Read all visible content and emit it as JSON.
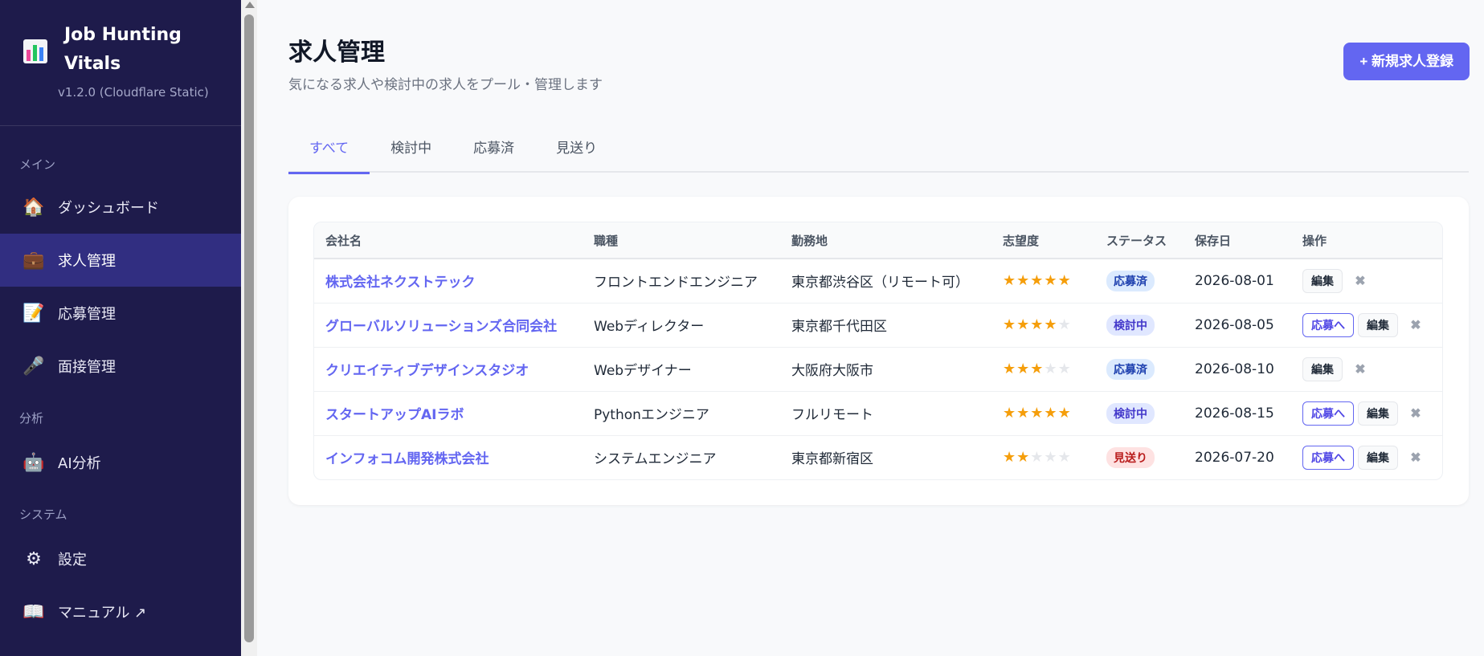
{
  "app": {
    "title": "Job Hunting Vitals",
    "version": "v1.2.0 (Cloudflare Static)"
  },
  "sidebar": {
    "sections": {
      "main": "メイン",
      "analysis": "分析",
      "system": "システム"
    },
    "items": [
      {
        "label": "ダッシュボード",
        "icon": "house-icon"
      },
      {
        "label": "求人管理",
        "icon": "briefcase-icon"
      },
      {
        "label": "応募管理",
        "icon": "memo-icon"
      },
      {
        "label": "面接管理",
        "icon": "microphone-icon"
      },
      {
        "label": "AI分析",
        "icon": "robot-icon"
      },
      {
        "label": "設定",
        "icon": "gear-icon"
      },
      {
        "label": "マニュアル ↗",
        "icon": "book-icon"
      }
    ]
  },
  "header": {
    "title": "求人管理",
    "subtitle": "気になる求人や検討中の求人をプール・管理します",
    "new_button": "+ 新規求人登録"
  },
  "tabs": [
    "すべて",
    "検討中",
    "応募済",
    "見送り"
  ],
  "table": {
    "columns": [
      "会社名",
      "職種",
      "勤務地",
      "志望度",
      "ステータス",
      "保存日",
      "操作"
    ],
    "rows": [
      {
        "company": "株式会社ネクストテック",
        "role": "フロントエンドエンジニア",
        "location": "東京都渋谷区（リモート可）",
        "rating": 5,
        "status": "応募済",
        "status_type": "blue",
        "date": "2026-08-01",
        "can_apply": false
      },
      {
        "company": "グローバルソリューションズ合同会社",
        "role": "Webディレクター",
        "location": "東京都千代田区",
        "rating": 4,
        "status": "検討中",
        "status_type": "gray",
        "date": "2026-08-05",
        "can_apply": true
      },
      {
        "company": "クリエイティブデザインスタジオ",
        "role": "Webデザイナー",
        "location": "大阪府大阪市",
        "rating": 3,
        "status": "応募済",
        "status_type": "blue",
        "date": "2026-08-10",
        "can_apply": false
      },
      {
        "company": "スタートアップAIラボ",
        "role": "Pythonエンジニア",
        "location": "フルリモート",
        "rating": 5,
        "status": "検討中",
        "status_type": "gray",
        "date": "2026-08-15",
        "can_apply": true
      },
      {
        "company": "インフォコム開発株式会社",
        "role": "システムエンジニア",
        "location": "東京都新宿区",
        "rating": 2,
        "status": "見送り",
        "status_type": "red",
        "date": "2026-07-20",
        "can_apply": true
      }
    ],
    "apply_label": "応募へ",
    "edit_label": "編集",
    "delete_label": "✖"
  },
  "colors": {
    "sidebar_bg": "#1e1b4b",
    "accent": "#6366f1",
    "star": "#f59e0b"
  }
}
